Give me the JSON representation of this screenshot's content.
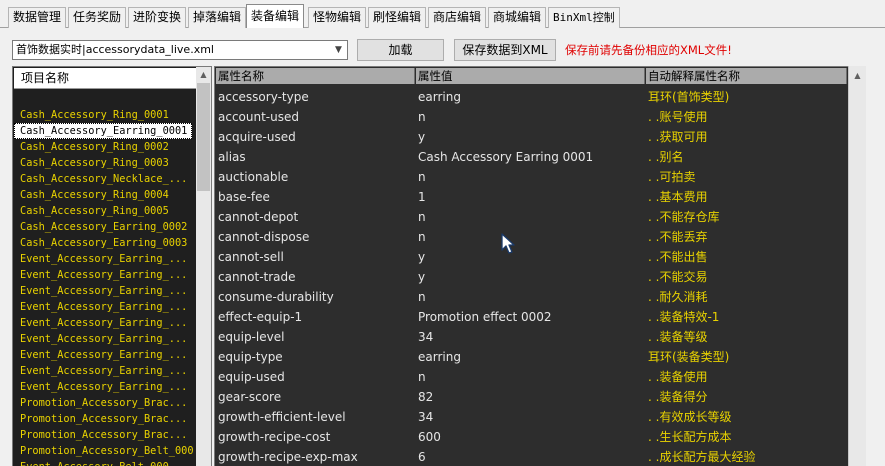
{
  "tabs": [
    {
      "label": "数据管理",
      "active": false
    },
    {
      "label": "任务奖励",
      "active": false
    },
    {
      "label": "进阶变换",
      "active": false
    },
    {
      "label": "掉落编辑",
      "active": false
    },
    {
      "label": "装备编辑",
      "active": true
    },
    {
      "label": "怪物编辑",
      "active": false
    },
    {
      "label": "刷怪编辑",
      "active": false
    },
    {
      "label": "商店编辑",
      "active": false
    },
    {
      "label": "商城编辑",
      "active": false
    },
    {
      "label": "BinXml控制",
      "active": false
    }
  ],
  "toolbar": {
    "file_select_value": "首饰数据实时|accessorydata_live.xml",
    "load_label": "加载",
    "save_label": "保存数据到XML",
    "warning": "保存前请先备份相应的XML文件!"
  },
  "left_panel": {
    "header": "项目名称",
    "items": [
      "Cash_Accessory_Ring_0001",
      "Cash_Accessory_Earring_0001",
      "Cash_Accessory_Ring_0002",
      "Cash_Accessory_Ring_0003",
      "Cash_Accessory_Necklace_...",
      "Cash_Accessory_Ring_0004",
      "Cash_Accessory_Ring_0005",
      "Cash_Accessory_Earring_0002",
      "Cash_Accessory_Earring_0003",
      "Event_Accessory_Earring_...",
      "Event_Accessory_Earring_...",
      "Event_Accessory_Earring_...",
      "Event_Accessory_Earring_...",
      "Event_Accessory_Earring_...",
      "Event_Accessory_Earring_...",
      "Event_Accessory_Earring_...",
      "Event_Accessory_Earring_...",
      "Event_Accessory_Earring_...",
      "Promotion_Accessory_Brac...",
      "Promotion_Accessory_Brac...",
      "Promotion_Accessory_Brac...",
      "Promotion_Accessory_Belt_000...",
      "Event_Accessory_Belt_000..."
    ],
    "selected_index": 1
  },
  "grid": {
    "columns": [
      "属性名称",
      "属性值",
      "自动解释属性名称"
    ],
    "rows": [
      [
        "accessory-type",
        "earring",
        "耳环(首饰类型)"
      ],
      [
        "account-used",
        "n",
        ".      .账号使用"
      ],
      [
        "acquire-used",
        "y",
        ".      .获取可用"
      ],
      [
        "alias",
        "Cash Accessory Earring 0001",
        ".      .别名"
      ],
      [
        "auctionable",
        "n",
        ".      .可拍卖"
      ],
      [
        "base-fee",
        "1",
        ".      .基本费用"
      ],
      [
        "cannot-depot",
        "n",
        ".      .不能存仓库"
      ],
      [
        "cannot-dispose",
        "n",
        ".      .不能丢弃"
      ],
      [
        "cannot-sell",
        "y",
        ".      .不能出售"
      ],
      [
        "cannot-trade",
        "y",
        ".      .不能交易"
      ],
      [
        "consume-durability",
        "n",
        ".      .耐久消耗"
      ],
      [
        "effect-equip-1",
        "Promotion effect 0002",
        ".      .装备特效-1"
      ],
      [
        "equip-level",
        "34",
        ".      .装备等级"
      ],
      [
        "equip-type",
        "earring",
        "耳环(装备类型)"
      ],
      [
        "equip-used",
        "n",
        ".      .装备使用"
      ],
      [
        "gear-score",
        "82",
        ".      .装备得分"
      ],
      [
        "growth-efficient-level",
        "34",
        ".      .有效成长等级"
      ],
      [
        "growth-recipe-cost",
        "600",
        ".      .生长配方成本"
      ],
      [
        "growth-recipe-exp-max",
        "6",
        ".      .成长配方最大经验"
      ]
    ]
  }
}
